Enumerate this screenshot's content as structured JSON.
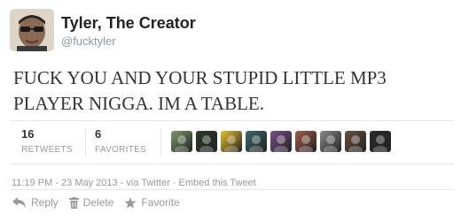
{
  "tweet": {
    "display_name": "Tyler, The Creator",
    "handle": "@fucktyler",
    "text": "FUCK YOU AND YOUR STUPID LITTLE MP3 PLAYER NIGGA. IM A TABLE."
  },
  "stats": {
    "retweets_count": "16",
    "retweets_label": "RETWEETS",
    "favorites_count": "6",
    "favorites_label": "FAVORITES"
  },
  "faces": [
    {
      "name": "avatar-1",
      "color": "#7c9a6a"
    },
    {
      "name": "avatar-2",
      "color": "#2f3a2a"
    },
    {
      "name": "avatar-3",
      "color": "#e8c02a"
    },
    {
      "name": "avatar-4",
      "color": "#3d6a6a"
    },
    {
      "name": "avatar-5",
      "color": "#7a4f8a"
    },
    {
      "name": "avatar-6",
      "color": "#a55a4a"
    },
    {
      "name": "avatar-7",
      "color": "#8a8a8a"
    },
    {
      "name": "avatar-8",
      "color": "#6a5040"
    },
    {
      "name": "avatar-9",
      "color": "#2a2a2a"
    }
  ],
  "meta": {
    "time": "11:19 PM - 23 May 2013",
    "sep1": " - via ",
    "via": "Twitter",
    "sep2": " · ",
    "embed": "Embed this Tweet"
  },
  "actions": {
    "reply": "Reply",
    "delete": "Delete",
    "favorite": "Favorite"
  },
  "colors": {
    "link_gray": "#999999",
    "handle_gray": "#8899a6"
  }
}
